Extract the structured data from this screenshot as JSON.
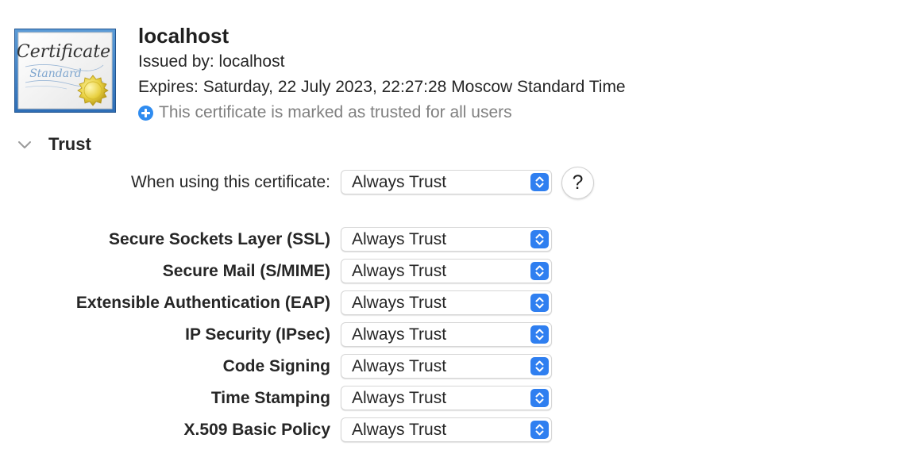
{
  "certificate": {
    "name": "localhost",
    "issued_by": "Issued by: localhost",
    "expires": "Expires: Saturday, 22 July 2023, 22:27:28 Moscow Standard Time",
    "trust_status": "This certificate is marked as trusted for all users",
    "icon_text_main": "Certificate",
    "icon_text_sub": "Standard",
    "icon": "certificate-icon",
    "status_icon": "plus-circle-icon"
  },
  "trust_section": {
    "heading": "Trust",
    "disclosure_icon": "chevron-down-icon",
    "when_using": {
      "label": "When using this certificate:",
      "value": "Always Trust"
    },
    "help_label": "?",
    "policies": [
      {
        "label": "Secure Sockets Layer (SSL)",
        "value": "Always Trust"
      },
      {
        "label": "Secure Mail (S/MIME)",
        "value": "Always Trust"
      },
      {
        "label": "Extensible Authentication (EAP)",
        "value": "Always Trust"
      },
      {
        "label": "IP Security (IPsec)",
        "value": "Always Trust"
      },
      {
        "label": "Code Signing",
        "value": "Always Trust"
      },
      {
        "label": "Time Stamping",
        "value": "Always Trust"
      },
      {
        "label": "X.509 Basic Policy",
        "value": "Always Trust"
      }
    ]
  },
  "colors": {
    "accent": "#2f7ff0",
    "secondary_text": "#808080",
    "primary_text": "#262626"
  }
}
